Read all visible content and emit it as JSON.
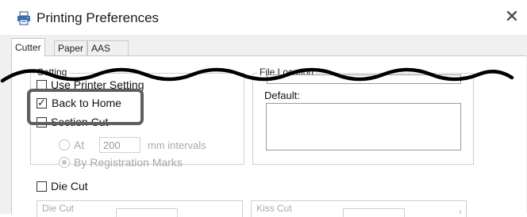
{
  "window": {
    "title": "Printing Preferences",
    "close_glyph": "✕"
  },
  "tabs": [
    {
      "label": "Cutter",
      "active": true
    },
    {
      "label": "Paper",
      "active": false
    },
    {
      "label": "AAS Installer",
      "active": false
    }
  ],
  "left_group": {
    "legend": "Setting",
    "partial_option": "Use Printer Setting",
    "back_to_home": {
      "label": "Back to Home",
      "checked": true
    },
    "section_cut": {
      "label": "Section Cut",
      "checked": false
    },
    "at_radio": {
      "label": "At",
      "selected": false,
      "enabled": false
    },
    "interval": {
      "value": "200",
      "unit": "mm intervals",
      "enabled": false
    },
    "registration_radio": {
      "label": "By Registration Marks",
      "selected": true,
      "enabled": false
    }
  },
  "right_group": {
    "legend": "File Location",
    "default_label": "Default:"
  },
  "die_cut": {
    "label": "Die Cut",
    "checked": false
  },
  "bottom": {
    "die_cut_group_legend": "Die Cut",
    "kiss_cut_group_legend": "Kiss Cut"
  },
  "colors": {
    "highlight": "#5f5f5f",
    "wave": "#000000",
    "disabled_text": "#a8a8a8"
  },
  "icons": {
    "app": "printer-icon",
    "close": "close-icon"
  }
}
